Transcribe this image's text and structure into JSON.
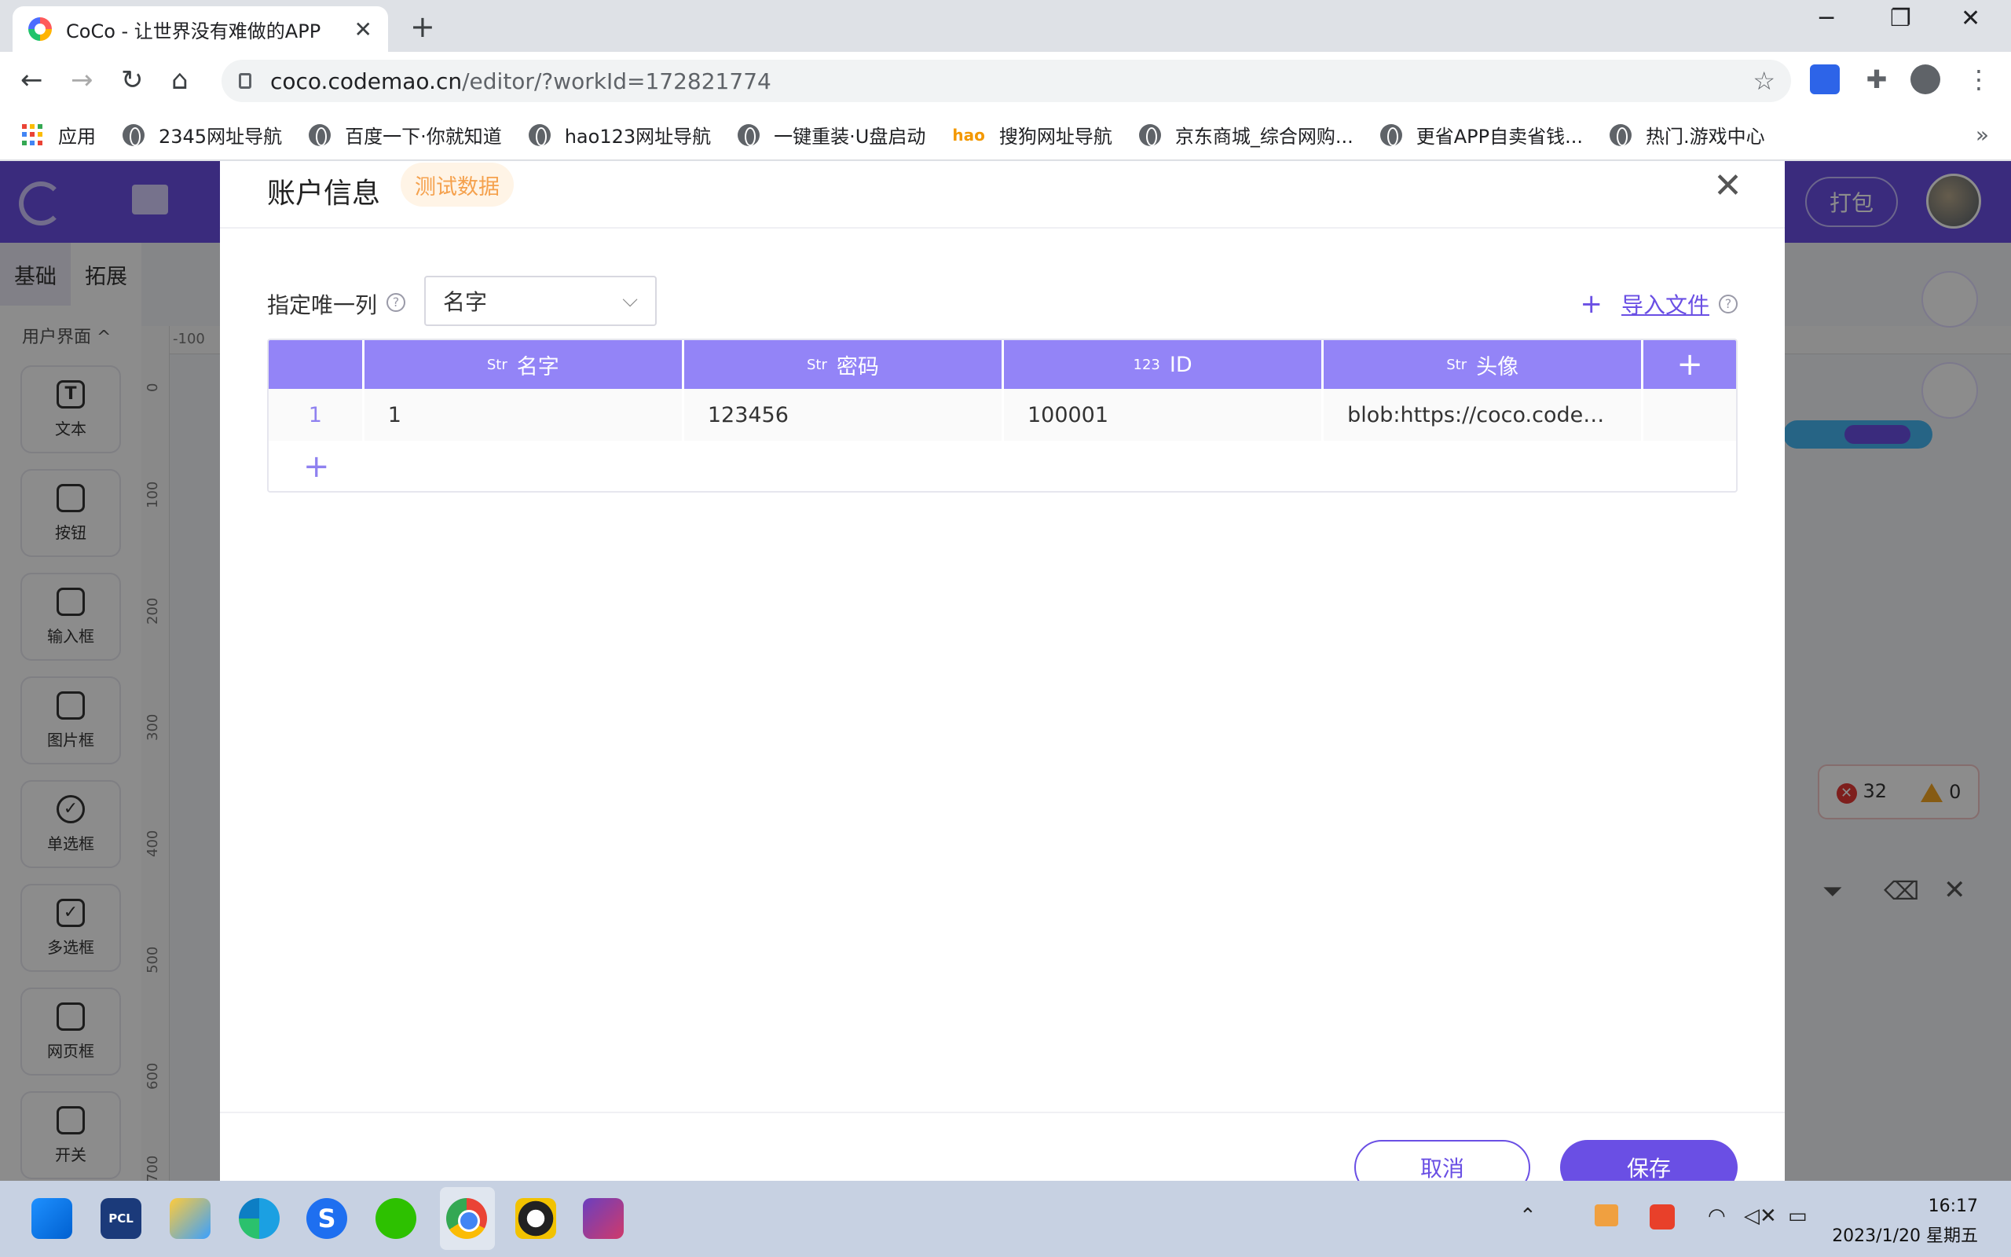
{
  "browser": {
    "tab_title": "CoCo - 让世界没有难做的APP",
    "tab_close": "✕",
    "new_tab": "+",
    "url_host": "coco.codemao.cn",
    "url_path": "/editor/?workId=172821774",
    "bookmarks": [
      {
        "label": "应用",
        "icon": "apps-grid-icon"
      },
      {
        "label": "2345网址导航",
        "icon": "globe-icon"
      },
      {
        "label": "百度一下·你就知道",
        "icon": "globe-icon"
      },
      {
        "label": "hao123网址导航",
        "icon": "globe-icon"
      },
      {
        "label": "一键重装·U盘启动",
        "icon": "globe-icon"
      },
      {
        "label": "搜狗网址导航",
        "icon": "hao-icon"
      },
      {
        "label": "京东商城_综合网购...",
        "icon": "globe-icon"
      },
      {
        "label": "更省APP自卖省钱...",
        "icon": "globe-icon"
      },
      {
        "label": "热门.游戏中心",
        "icon": "globe-icon"
      }
    ],
    "bookmark_more": "»"
  },
  "editor": {
    "pack_label": "打包",
    "left_tabs": [
      "基础",
      "拓展"
    ],
    "section_label": "用户界面",
    "widgets": [
      "文本",
      "按钮",
      "输入框",
      "图片框",
      "单选框",
      "多选框",
      "网页框",
      "开关"
    ],
    "ruler_h_label": "-100",
    "ruler_labels": [
      "0",
      "100",
      "200",
      "300",
      "400",
      "500",
      "600",
      "700"
    ],
    "error_count": "32",
    "warning_count": "0"
  },
  "modal": {
    "title": "账户信息",
    "tag": "测试数据",
    "close": "✕",
    "unique_label": "指定唯一列",
    "unique_value": "名字",
    "import_label": "导入文件",
    "columns": [
      {
        "type": "Str",
        "name": "名字"
      },
      {
        "type": "Str",
        "name": "密码"
      },
      {
        "type": "123",
        "name": "ID"
      },
      {
        "type": "Str",
        "name": "头像"
      }
    ],
    "rows": [
      {
        "index": "1",
        "cells": [
          "1",
          "123456",
          "100001",
          "blob:https://coco.code…"
        ]
      }
    ],
    "add_column": "+",
    "add_row": "+",
    "cancel": "取消",
    "save": "保存"
  },
  "taskbar": {
    "pcl_label": "PCL",
    "sogou_label": "S",
    "time": "16:17",
    "date": "2023/1/20 星期五"
  }
}
